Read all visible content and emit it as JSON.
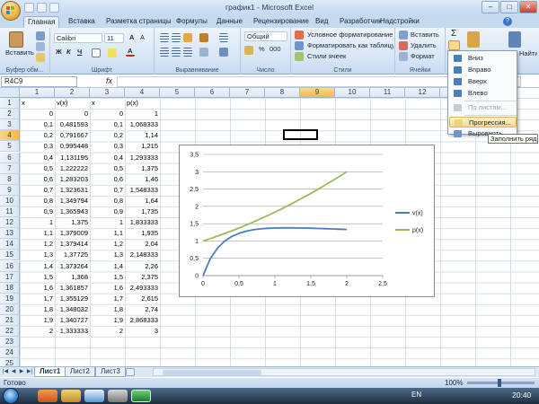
{
  "window": {
    "title": "график1 - Microsoft Excel",
    "minimize": "–",
    "maximize": "□",
    "close": "✕"
  },
  "tabs": [
    "Главная",
    "Вставка",
    "Разметка страницы",
    "Формулы",
    "Данные",
    "Рецензирование",
    "Вид",
    "Разработчик",
    "Надстройки"
  ],
  "ribbon": {
    "clipboard": {
      "paste": "Вставить",
      "label": "Буфер обм..."
    },
    "font": {
      "name": "Calibri",
      "size": "11",
      "grow": "A",
      "shrink": "A",
      "bold": "Ж",
      "italic": "К",
      "underline": "Ч",
      "color": "A",
      "label": "Шрифт"
    },
    "alignment": {
      "label": "Выравнивание"
    },
    "number": {
      "format": "Общий",
      "percent": "%",
      "thousands": "000",
      "label": "Число"
    },
    "styles": {
      "conditional": "Условное форматирование",
      "table": "Форматировать как таблицу",
      "cell_styles": "Стили ячеек",
      "label": "Стили"
    },
    "cells": {
      "insert": "Вставить",
      "delete": "Удалить",
      "format": "Формат",
      "label": "Ячейки"
    },
    "editing": {
      "sigma": "Σ",
      "sort": "Сортировка",
      "find": "Найти и"
    }
  },
  "formula_bar": {
    "name_box": "R4C9",
    "fx": "fx",
    "content": ""
  },
  "columns": [
    "1",
    "2",
    "3",
    "4",
    "5",
    "6",
    "7",
    "8",
    "9",
    "10",
    "11",
    "12",
    "13"
  ],
  "selected_column": "9",
  "selected_row": "4",
  "rows": [
    [
      "x",
      "v(x)",
      "x",
      "p(x)"
    ],
    [
      "0",
      "0",
      "0",
      "1"
    ],
    [
      "0,1",
      "0,481593",
      "0,1",
      "1,068333"
    ],
    [
      "0,2",
      "0,791667",
      "0,2",
      "1,14"
    ],
    [
      "0,3",
      "0,995448",
      "0,3",
      "1,215"
    ],
    [
      "0,4",
      "1,131195",
      "0,4",
      "1,293333"
    ],
    [
      "0,5",
      "1,222222",
      "0,5",
      "1,375"
    ],
    [
      "0,6",
      "1,283203",
      "0,6",
      "1,46"
    ],
    [
      "0,7",
      "1,323631",
      "0,7",
      "1,548333"
    ],
    [
      "0,8",
      "1,349794",
      "0,8",
      "1,64"
    ],
    [
      "0,9",
      "1,365943",
      "0,9",
      "1,735"
    ],
    [
      "1",
      "1,375",
      "1",
      "1,833333"
    ],
    [
      "1,1",
      "1,379009",
      "1,1",
      "1,935"
    ],
    [
      "1,2",
      "1,379414",
      "1,2",
      "2,04"
    ],
    [
      "1,3",
      "1,37725",
      "1,3",
      "2,148333"
    ],
    [
      "1,4",
      "1,373264",
      "1,4",
      "2,26"
    ],
    [
      "1,5",
      "1,368",
      "1,5",
      "2,375"
    ],
    [
      "1,6",
      "1,361857",
      "1,6",
      "2,493333"
    ],
    [
      "1,7",
      "1,355129",
      "1,7",
      "2,615"
    ],
    [
      "1,8",
      "1,348032",
      "1,8",
      "2,74"
    ],
    [
      "1,9",
      "1,340727",
      "1,9",
      "2,868333"
    ],
    [
      "2",
      "1,333333",
      "2",
      "3"
    ]
  ],
  "fill_menu": {
    "items": [
      {
        "label": "Вниз",
        "state": "normal"
      },
      {
        "label": "Вправо",
        "state": "normal"
      },
      {
        "label": "Вверх",
        "state": "normal"
      },
      {
        "label": "Влево",
        "state": "normal"
      },
      {
        "label": "По листам...",
        "state": "disabled"
      },
      {
        "label": "Прогрессия...",
        "state": "hover"
      },
      {
        "label": "Выровнять",
        "state": "normal"
      }
    ],
    "tooltip": "Заполнить ряд"
  },
  "sheet_tabs": [
    "Лист1",
    "Лист2",
    "Лист3"
  ],
  "active_sheet": "Лист1",
  "status": {
    "text": "Готово",
    "zoom": "100%"
  },
  "taskbar": {
    "lang": "EN",
    "time": "20:40"
  },
  "colors": {
    "series_v": "#4a7ebb",
    "series_p": "#9bbb59",
    "ribbon": "#d6e4f6",
    "accent": "#f7b94a"
  },
  "chart_data": {
    "type": "line",
    "title": "",
    "xlabel": "",
    "ylabel": "",
    "xlim": [
      0,
      2.5
    ],
    "ylim": [
      0,
      3.5
    ],
    "xticks": [
      "0",
      "0,5",
      "1",
      "1,5",
      "2",
      "2,5"
    ],
    "yticks": [
      "0",
      "0,5",
      "1",
      "1,5",
      "2",
      "2,5",
      "3",
      "3,5"
    ],
    "grid": true,
    "legend": "right",
    "series": [
      {
        "name": "v(x)",
        "color": "#4a7ebb",
        "x": [
          0,
          0.1,
          0.2,
          0.3,
          0.4,
          0.5,
          0.6,
          0.7,
          0.8,
          0.9,
          1,
          1.1,
          1.2,
          1.3,
          1.4,
          1.5,
          1.6,
          1.7,
          1.8,
          1.9,
          2
        ],
        "y": [
          0,
          0.481593,
          0.791667,
          0.995448,
          1.131195,
          1.222222,
          1.283203,
          1.323631,
          1.349794,
          1.365943,
          1.375,
          1.379009,
          1.379414,
          1.37725,
          1.373264,
          1.368,
          1.361857,
          1.355129,
          1.348032,
          1.340727,
          1.333333
        ]
      },
      {
        "name": "p(x)",
        "color": "#9bbb59",
        "x": [
          0,
          0.1,
          0.2,
          0.3,
          0.4,
          0.5,
          0.6,
          0.7,
          0.8,
          0.9,
          1,
          1.1,
          1.2,
          1.3,
          1.4,
          1.5,
          1.6,
          1.7,
          1.8,
          1.9,
          2
        ],
        "y": [
          1,
          1.068333,
          1.14,
          1.215,
          1.293333,
          1.375,
          1.46,
          1.548333,
          1.64,
          1.735,
          1.833333,
          1.935,
          2.04,
          2.148333,
          2.26,
          2.375,
          2.493333,
          2.615,
          2.74,
          2.868333,
          3
        ]
      }
    ]
  }
}
